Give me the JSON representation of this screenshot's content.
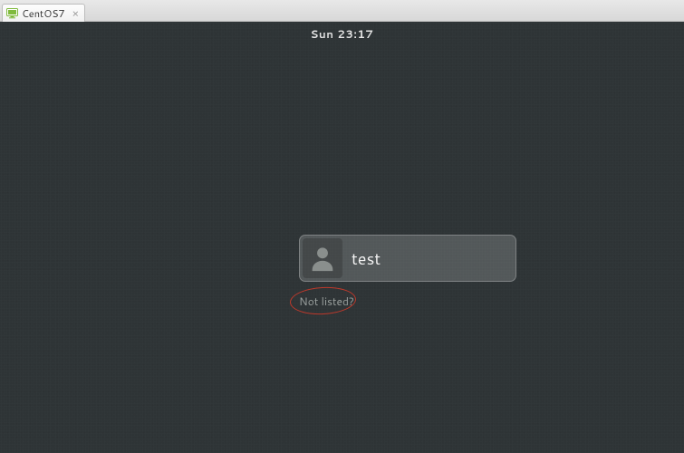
{
  "tab": {
    "label": "CentOS7",
    "close_glyph": "×"
  },
  "topbar": {
    "clock": "Sun 23:17"
  },
  "login": {
    "username": "test",
    "not_listed": "Not listed?"
  }
}
